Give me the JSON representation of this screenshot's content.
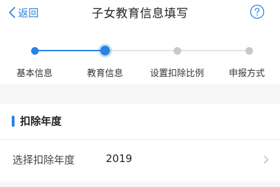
{
  "nav": {
    "back_label": "返回",
    "title": "子女教育信息填写",
    "help_icon": "question-circle-icon",
    "back_icon": "chevron-left-icon"
  },
  "steps": [
    {
      "label": "基本信息",
      "state": "done"
    },
    {
      "label": "教育信息",
      "state": "current"
    },
    {
      "label": "设置扣除比例",
      "state": "pending"
    },
    {
      "label": "申报方式",
      "state": "pending"
    }
  ],
  "section": {
    "title": "扣除年度",
    "rows": [
      {
        "label": "选择扣除年度",
        "value": "2019",
        "icon": "chevron-right-icon"
      }
    ]
  },
  "colors": {
    "accent": "#2a82e4",
    "inactive": "#c8c8cc",
    "background": "#f5f6f8"
  }
}
